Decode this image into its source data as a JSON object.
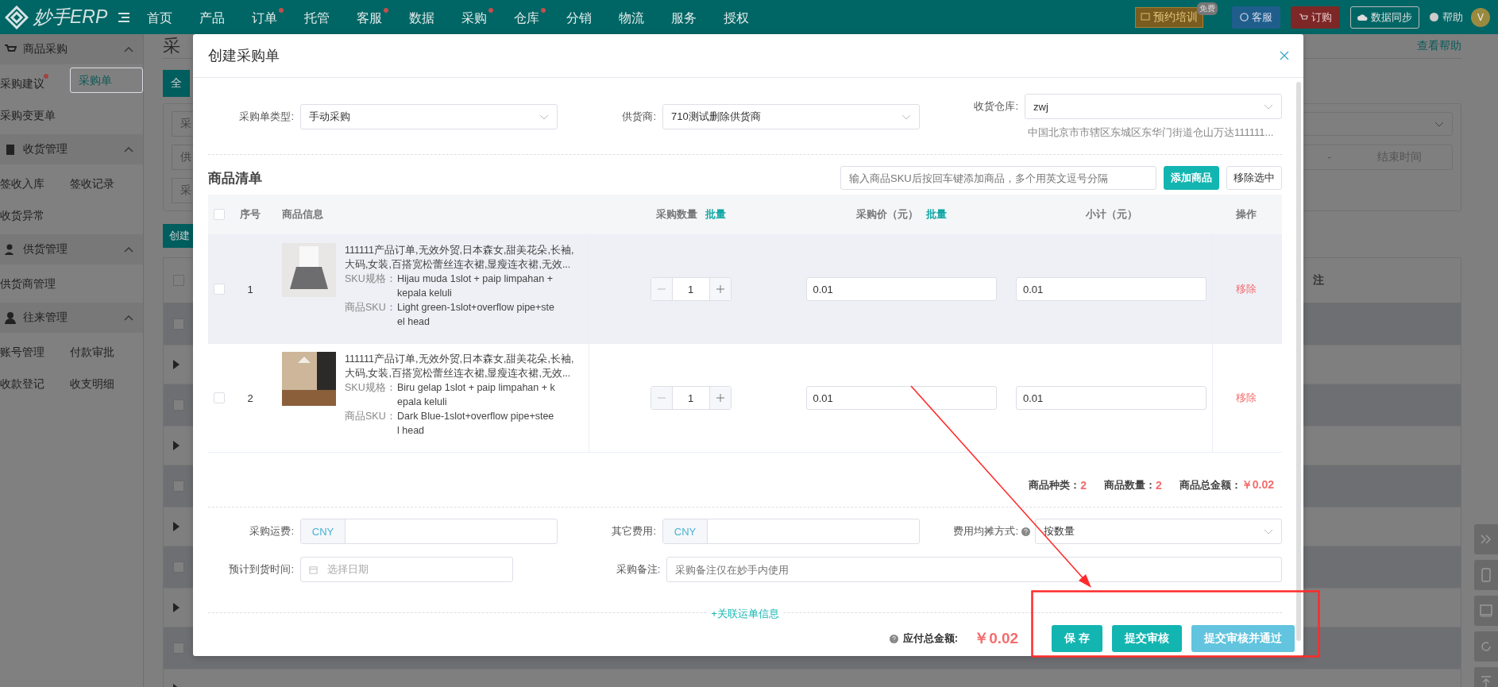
{
  "nav": {
    "logo": "妙手ERP",
    "items": [
      {
        "label": "首页",
        "dot": false
      },
      {
        "label": "产品",
        "dot": false
      },
      {
        "label": "订单",
        "dot": true
      },
      {
        "label": "托管",
        "dot": false
      },
      {
        "label": "客服",
        "dot": true
      },
      {
        "label": "数据",
        "dot": false
      },
      {
        "label": "采购",
        "dot": true
      },
      {
        "label": "仓库",
        "dot": true
      },
      {
        "label": "分销",
        "dot": false
      },
      {
        "label": "物流",
        "dot": false
      },
      {
        "label": "服务",
        "dot": false
      },
      {
        "label": "授权",
        "dot": false
      }
    ],
    "training": "预约培训",
    "training_badge": "免费",
    "service": "客服",
    "order": "订购",
    "sync": "数据同步",
    "help": "帮助",
    "avatar": "V"
  },
  "sidebar": [
    {
      "title": "商品采购",
      "expanded": true,
      "items": [
        {
          "label": "采购建议",
          "dot": true,
          "selected": false
        },
        {
          "label": "采购单",
          "dot": false,
          "selected": true
        },
        {
          "label": "采购变更单",
          "dot": false,
          "selected": false
        }
      ]
    },
    {
      "title": "收货管理",
      "expanded": true,
      "items": [
        {
          "label": "签收入库",
          "dot": false,
          "selected": false
        },
        {
          "label": "签收记录",
          "dot": false,
          "selected": false
        },
        {
          "label": "收货异常",
          "dot": false,
          "selected": false
        }
      ]
    },
    {
      "title": "供货管理",
      "expanded": true,
      "items": [
        {
          "label": "供货商管理",
          "dot": false,
          "selected": false
        }
      ]
    },
    {
      "title": "往来管理",
      "expanded": true,
      "items": [
        {
          "label": "账号管理",
          "dot": false,
          "selected": false
        },
        {
          "label": "付款审批",
          "dot": false,
          "selected": false
        },
        {
          "label": "收款登记",
          "dot": false,
          "selected": false
        },
        {
          "label": "收支明细",
          "dot": false,
          "selected": false
        }
      ]
    }
  ],
  "page": {
    "title": "采",
    "help_link": "查看帮助",
    "tab": "全",
    "filters": [
      "采",
      "供",
      "采"
    ],
    "range_separator": "-",
    "range_end": "结束时间",
    "create_button": "创建",
    "column_remark": "注",
    "header_checked": false,
    "rows": [
      {
        "kind": "check",
        "checked": false
      },
      {
        "kind": "expand"
      },
      {
        "kind": "check",
        "checked": false
      },
      {
        "kind": "expand"
      },
      {
        "kind": "check",
        "checked": false
      },
      {
        "kind": "expand"
      },
      {
        "kind": "check",
        "checked": false
      },
      {
        "kind": "expand"
      },
      {
        "kind": "check",
        "checked": false
      },
      {
        "kind": "expand"
      }
    ]
  },
  "modal": {
    "title": "创建采购单",
    "type_label": "采购单类型:",
    "type_value": "手动采购",
    "supplier_label": "供货商:",
    "supplier_value": "710测试删除供货商",
    "warehouse_label": "收货仓库:",
    "warehouse_value": "zwj",
    "warehouse_address": "中国北京市市辖区东城区东华门街道仓山万达111111...",
    "list_title": "商品清单",
    "sku_placeholder": "输入商品SKU后按回车键添加商品，多个用英文逗号分隔",
    "add_button": "添加商品",
    "remove_selected": "移除选中",
    "all_checked": false,
    "columns": {
      "index": "序号",
      "info": "商品信息",
      "qty": "采购数量",
      "qty_batch": "批量",
      "price": "采购价（元）",
      "price_batch": "批量",
      "subtotal": "小计（元）",
      "action": "操作"
    },
    "rows": [
      {
        "index": "1",
        "title": "111111产品订单,无效外贸,日本森女,甜美花朵,长袖,大码,女装,百搭宽松蕾丝连衣裙,显瘦连衣裙,无效...",
        "spec_label": "SKU规格：",
        "spec": "Hijau muda 1slot + paip limpahan + kepala keluli",
        "sku_label": "商品SKU：",
        "sku": "Light green-1slot+overflow pipe+steel head",
        "qty": "1",
        "price": "0.01",
        "subtotal": "0.01",
        "action": "移除",
        "checked": false,
        "hovered": true
      },
      {
        "index": "2",
        "title": "111111产品订单,无效外贸,日本森女,甜美花朵,长袖,大码,女装,百搭宽松蕾丝连衣裙,显瘦连衣裙,无效...",
        "spec_label": "SKU规格：",
        "spec": "Biru gelap 1slot + paip limpahan + kepala keluli",
        "sku_label": "商品SKU：",
        "sku": "Dark Blue-1slot+overflow pipe+steel head",
        "qty": "1",
        "price": "0.01",
        "subtotal": "0.01",
        "action": "移除",
        "checked": false,
        "hovered": false
      }
    ],
    "summary": [
      {
        "label": "商品种类：",
        "value": "2"
      },
      {
        "label": "商品数量：",
        "value": "2"
      },
      {
        "label": "商品总金额：",
        "value": "￥0.02"
      }
    ],
    "freight_label": "采购运费:",
    "freight_currency": "CNY",
    "other_label": "其它费用:",
    "other_currency": "CNY",
    "split_label": "费用均摊方式:",
    "split_value": "按数量",
    "arrival_label": "预计到货时间:",
    "arrival_placeholder": "选择日期",
    "remark_label": "采购备注:",
    "remark_placeholder": "采购备注仅在妙手内使用",
    "link": "+关联运单信息",
    "total_label": "应付总金额:",
    "total_value": "￥0.02",
    "buttons": [
      {
        "label": "保 存",
        "kind": "primary"
      },
      {
        "label": "提交审核",
        "kind": "primary"
      },
      {
        "label": "提交审核并通过",
        "kind": "light"
      }
    ]
  }
}
